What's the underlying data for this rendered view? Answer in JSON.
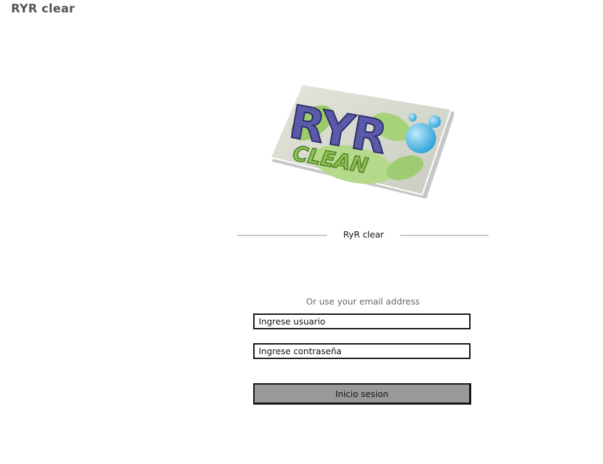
{
  "app": {
    "title": "RYR clear"
  },
  "logo": {
    "text_main": "RYR",
    "text_sub": "CLEAN"
  },
  "divider": {
    "label": "RyR clear"
  },
  "login": {
    "hint": "Or use your email address",
    "username_placeholder": "Ingrese usuario",
    "password_placeholder": "Ingrese contraseña",
    "submit_label": "Inicio sesion"
  },
  "colors": {
    "title_gray": "#555555",
    "button_gray": "#999999",
    "logo_purple": "#5b5aa8",
    "logo_green": "#8cc152",
    "logo_blue": "#35a8e0"
  }
}
